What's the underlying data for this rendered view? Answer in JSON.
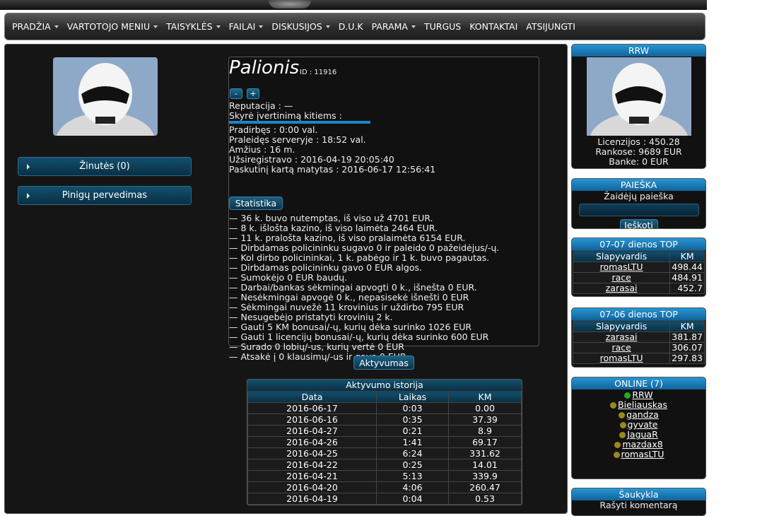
{
  "nav": {
    "items": [
      {
        "label": "PRADŽIA",
        "dropdown": true
      },
      {
        "label": "VARTOTOJO MENIU",
        "dropdown": true
      },
      {
        "label": "TAISYKLĖS",
        "dropdown": true
      },
      {
        "label": "FAILAI",
        "dropdown": true
      },
      {
        "label": "DISKUSIJOS",
        "dropdown": true
      },
      {
        "label": "D.U.K",
        "dropdown": false
      },
      {
        "label": "PARAMA",
        "dropdown": true
      },
      {
        "label": "TURGUS",
        "dropdown": false
      },
      {
        "label": "KONTAKTAI",
        "dropdown": false
      },
      {
        "label": "ATSIJUNGTI",
        "dropdown": false
      }
    ]
  },
  "left": {
    "messages_button": "Žinutės (0)",
    "transfer_button": "Pinigų pervedimas"
  },
  "profile": {
    "name": "Palionis",
    "id_label": "ID : 11916",
    "minus": "-",
    "plus": "+",
    "reputation": "Reputacija : —",
    "rated_others": "Skyrė įvertinimą kitiems :",
    "worked": "Pradirbęs : 0:00 val.",
    "spent": "Praleidęs serveryje : 18:52 val.",
    "age": "Amžius : 16 m.",
    "registered": "Užsiregistravo : 2016-04-19 20:05:40",
    "last_seen": "Paskutinį kartą matytas : 2016-06-17 12:56:41",
    "stats_button": "Statistika",
    "stats": [
      "— 36 k. buvo nutemptas, iš viso už 4701 EUR.",
      "— 8 k. išlošta kazino, iš viso laimėta 2464 EUR.",
      "— 11 k. pralošta kazino, iš viso pralaimėta 6154 EUR.",
      "— Dirbdamas policininku sugavo 0 ir paleido 0 pažeidėjus/-ų.",
      "— Kol dirbo policininkai, 1 k. pabėgo ir 1 k. buvo pagautas.",
      "— Dirbdamas policininku gavo 0 EUR algos.",
      "— Sumokėjo 0 EUR baudų.",
      "— Darbai/bankas sėkmingai apvogti 0 k., išnešta 0 EUR.",
      "— Nesėkmingai apvogė 0 k., nepasisekė išnešti 0 EUR",
      "— Sėkmingai nuvežė 11 krovinius ir uždirbo 795 EUR",
      "— Nesugebėjo pristatyti krovinių 2 k.",
      "— Gauti 5 KM bonusai/-ų, kurių dėka surinko 1026 EUR",
      "— Gauti 1 licencijų bonusai/-ų, kurių dėka surinko 600 EUR",
      "— Surado 0 lobių/-us, kurių vertė 0 EUR",
      "— Atsakė į 0 klausimų/-us ir gavo 0 EUR"
    ]
  },
  "activity": {
    "button": "Aktyvumas",
    "title": "Aktyvumo istorija",
    "columns": [
      "Data",
      "Laikas",
      "KM"
    ],
    "rows": [
      [
        "2016-06-17",
        "0:03",
        "0.00"
      ],
      [
        "2016-06-16",
        "0:35",
        "37.39"
      ],
      [
        "2016-04-27",
        "0:21",
        "8.9"
      ],
      [
        "2016-04-26",
        "1:41",
        "69.17"
      ],
      [
        "2016-04-25",
        "6:24",
        "331.62"
      ],
      [
        "2016-04-22",
        "0:25",
        "14.01"
      ],
      [
        "2016-04-21",
        "5:13",
        "339.9"
      ],
      [
        "2016-04-20",
        "4:06",
        "260.47"
      ],
      [
        "2016-04-19",
        "0:04",
        "0.53"
      ]
    ]
  },
  "right": {
    "user_panel": {
      "title": "RRW",
      "licenses": "Licenzijos : 450.28",
      "hand": "Rankose: 9689 EUR",
      "bank": "Banke: 0 EUR"
    },
    "search": {
      "title": "PAIEŠKA",
      "label": "Žaidėjų paieška",
      "button": "Ieškoti"
    },
    "top1": {
      "title": "07-07 dienos TOP",
      "columns": [
        "Slapyvardis",
        "KM"
      ],
      "rows": [
        [
          "romasLTU",
          "498.44"
        ],
        [
          "race",
          "484.91"
        ],
        [
          "zarasai",
          "452.7"
        ]
      ]
    },
    "top2": {
      "title": "07-06 dienos TOP",
      "columns": [
        "Slapyvardis",
        "KM"
      ],
      "rows": [
        [
          "zarasai",
          "381.87"
        ],
        [
          "race",
          "306.07"
        ],
        [
          "romasLTU",
          "297.83"
        ]
      ]
    },
    "online": {
      "title": "ONLINE (7)",
      "users": [
        {
          "name": "RRW",
          "status": "green"
        },
        {
          "name": "Bieliauskas",
          "status": "olive"
        },
        {
          "name": "gandza",
          "status": "olive"
        },
        {
          "name": "gyvate",
          "status": "olive"
        },
        {
          "name": "JaguaR",
          "status": "olive"
        },
        {
          "name": "mazdax8",
          "status": "olive"
        },
        {
          "name": "romasLTU",
          "status": "olive"
        }
      ]
    },
    "shout": {
      "title": "Šaukykla",
      "write": "Rašyti komentarą"
    }
  },
  "colors": {
    "accent": "#2696d3",
    "green": "#22aa22",
    "olive": "#9a8a1a"
  }
}
